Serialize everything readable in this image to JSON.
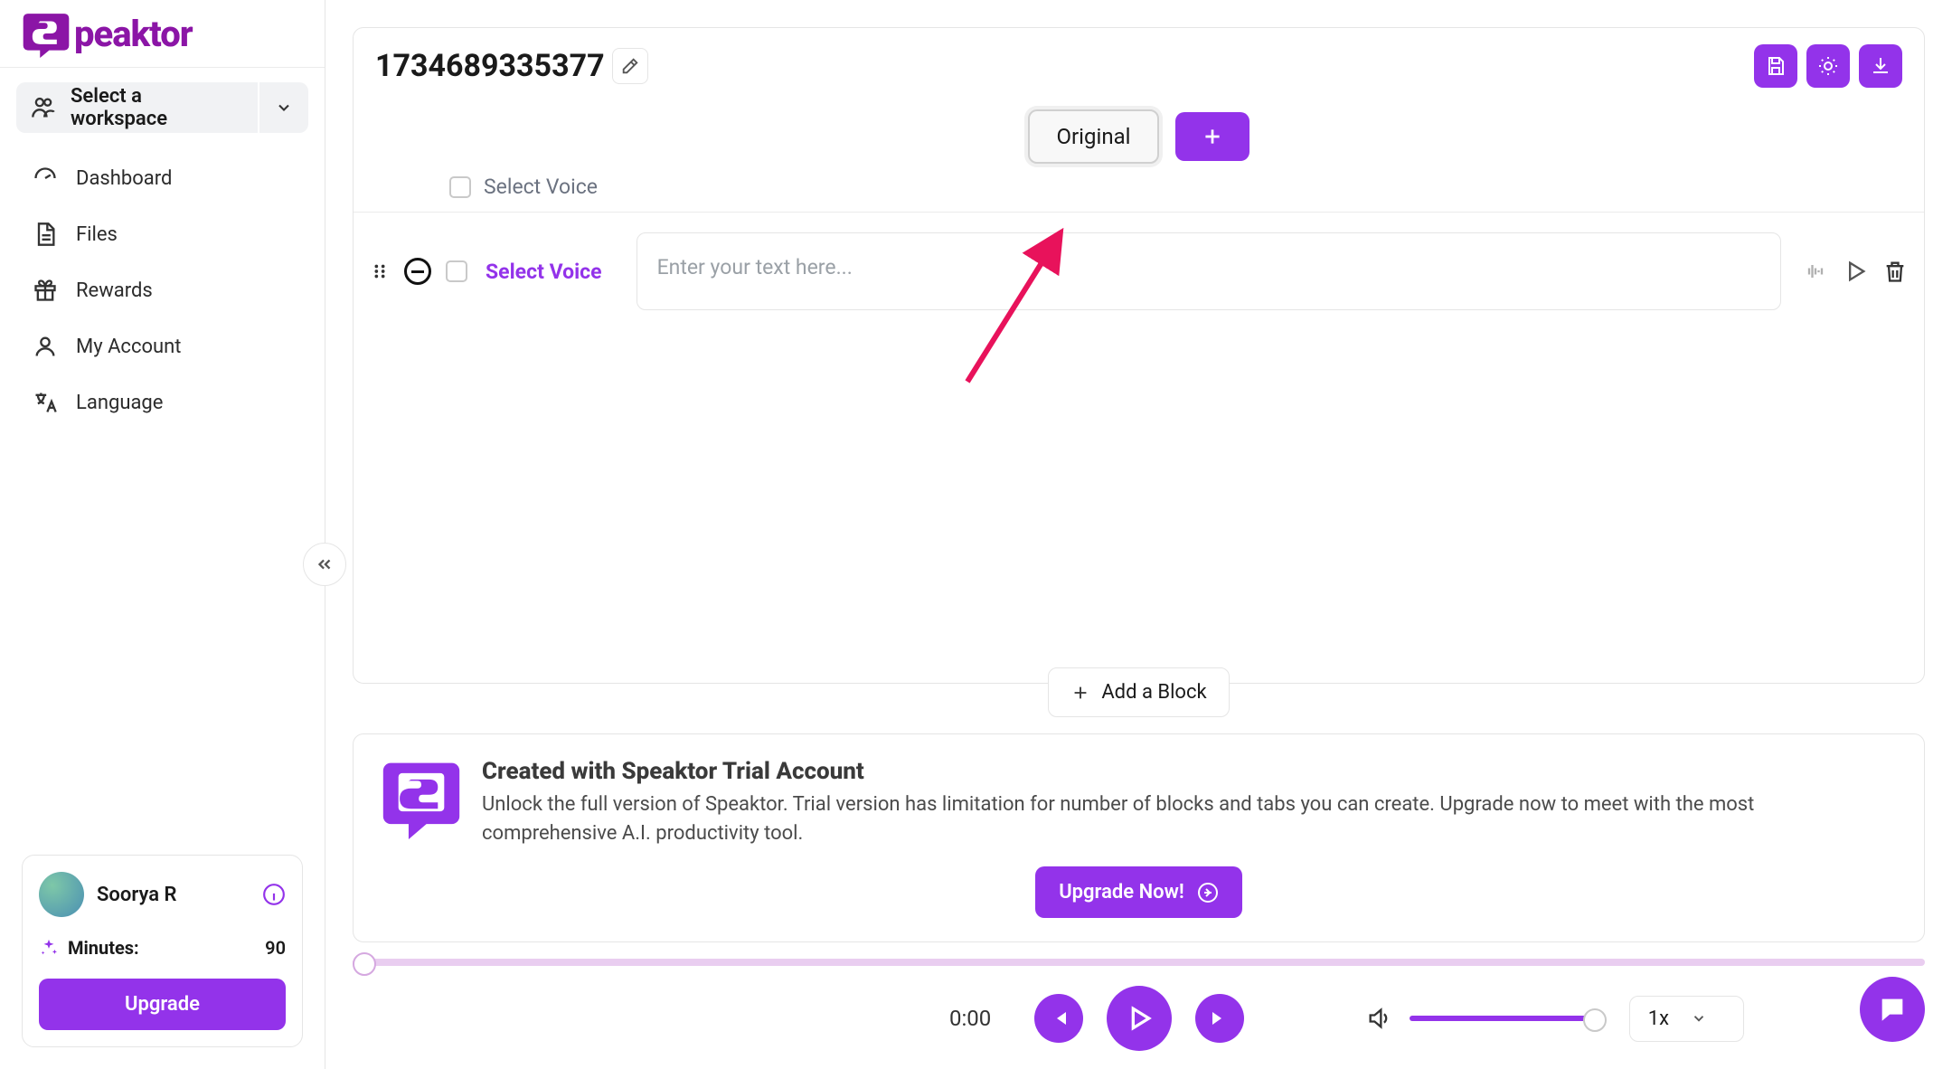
{
  "brand": {
    "name": "peaktor"
  },
  "sidebar": {
    "workspace_label": "Select a workspace",
    "items": [
      {
        "label": "Dashboard"
      },
      {
        "label": "Files"
      },
      {
        "label": "Rewards"
      },
      {
        "label": "My Account"
      },
      {
        "label": "Language"
      }
    ]
  },
  "user": {
    "name": "Soorya R",
    "minutes_label": "Minutes:",
    "minutes_value": "90",
    "upgrade_label": "Upgrade"
  },
  "doc": {
    "title": "1734689335377",
    "tabs": {
      "original": "Original"
    },
    "header_select_voice": "Select Voice"
  },
  "block": {
    "select_voice": "Select Voice",
    "placeholder": "Enter your text here..."
  },
  "add_block": "Add a Block",
  "trial": {
    "title": "Created with Speaktor Trial Account",
    "desc": "Unlock the full version of Speaktor. Trial version has limitation for number of blocks and tabs you can create. Upgrade now to meet with the most comprehensive A.I. productivity tool.",
    "cta": "Upgrade Now!"
  },
  "player": {
    "time": "0:00",
    "speed": "1x"
  },
  "colors": {
    "accent": "#9333ea"
  }
}
